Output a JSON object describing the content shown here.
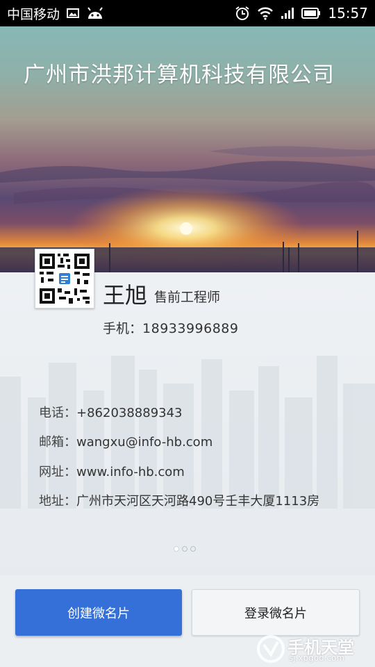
{
  "status_bar": {
    "carrier": "中国移动",
    "time": "15:57"
  },
  "card": {
    "company": "广州市洪邦计算机科技有限公司",
    "name": "王旭",
    "title": "售前工程师",
    "mobile_label": "手机：",
    "mobile_value": "18933996889",
    "rows": [
      {
        "label": "电话：",
        "value": "+862038889343"
      },
      {
        "label": "邮箱：",
        "value": "wangxu@info-hb.com"
      },
      {
        "label": "网址：",
        "value": "www.info-hb.com"
      },
      {
        "label": "地址：",
        "value": "广州市天河区天河路490号壬丰大厦1113房"
      }
    ]
  },
  "pager": {
    "current": 1,
    "total": 3
  },
  "buttons": {
    "create": "创建微名片",
    "login": "登录微名片"
  },
  "watermark": {
    "text": "手机天堂",
    "url": "sj.xpgod.com"
  },
  "colors": {
    "accent": "#3470d8",
    "status_bar": "#000000"
  }
}
